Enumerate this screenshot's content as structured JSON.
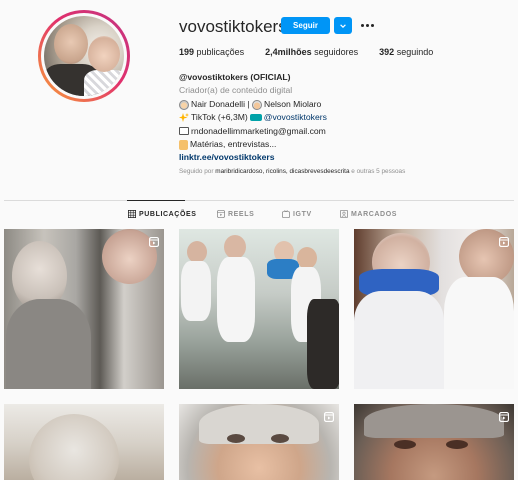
{
  "profile": {
    "username": "vovostiktokers",
    "follow_label": "Seguir",
    "stats": [
      {
        "value": "199",
        "label": "publicações"
      },
      {
        "value": "2,4milhões",
        "label": "seguidores"
      },
      {
        "value": "392",
        "label": "seguindo"
      }
    ],
    "bio": {
      "name": "@vovostiktokers (OFICIAL)",
      "category": "Criador(a) de conteúdo digital",
      "line1_a": "Nair Donadelli |",
      "line1_b": "Nelson Miolaro",
      "line2_a": "TikTok (+6,3M)",
      "line2_mention": "@vovostiktokers",
      "line3": "rndonadellimmarketing@gmail.com",
      "line4": "Matérias, entrevistas...",
      "link": "linktr.ee/vovostiktokers"
    },
    "followed_by": {
      "prefix": "Seguido por",
      "names": "maribridicardoso, ricolins, dicasbrevesdeescrita",
      "suffix": "e outras 5 pessoas"
    }
  },
  "tabs": [
    {
      "label": "PUBLICAÇÕES",
      "icon": "grid-icon",
      "active": true
    },
    {
      "label": "REELS",
      "icon": "reels-icon",
      "active": false
    },
    {
      "label": "IGTV",
      "icon": "igtv-icon",
      "active": false
    },
    {
      "label": "MARCADOS",
      "icon": "tagged-icon",
      "active": false
    }
  ],
  "posts": [
    {
      "type": "reel",
      "icon": "reel-icon"
    },
    {
      "type": "photo",
      "icon": ""
    },
    {
      "type": "reel",
      "icon": "reel-icon"
    },
    {
      "type": "photo",
      "icon": ""
    },
    {
      "type": "reel",
      "icon": "reel-icon"
    },
    {
      "type": "reel",
      "icon": "reel-icon"
    }
  ],
  "colors": {
    "accent": "#0095f6",
    "link": "#00376b",
    "muted": "#8e8e8e",
    "text": "#262626"
  }
}
